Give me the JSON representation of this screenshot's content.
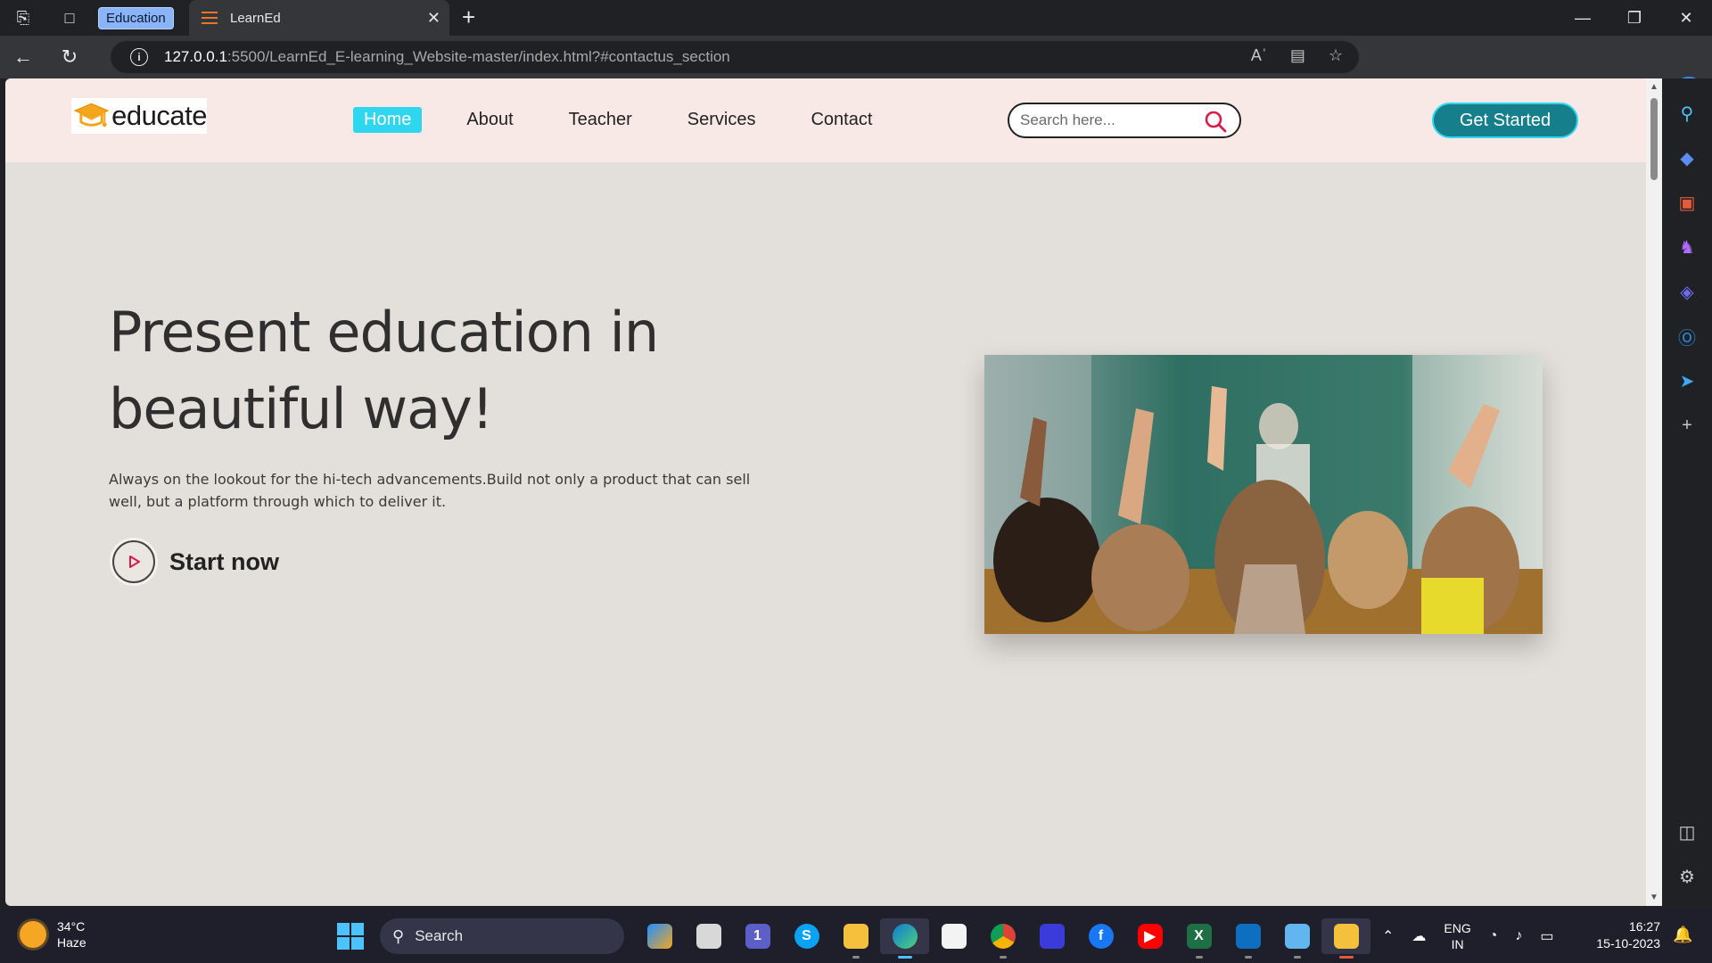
{
  "browser": {
    "tab_group_label": "Education",
    "tab_title": "LearnEd",
    "url_host": "127.0.0.1",
    "url_path": ":5500/LearnEd_E-learning_Website-master/index.html?#contactus_section"
  },
  "site": {
    "logo_text": "educate",
    "nav": [
      {
        "label": "Home",
        "active": true
      },
      {
        "label": "About"
      },
      {
        "label": "Teacher"
      },
      {
        "label": "Services"
      },
      {
        "label": "Contact"
      }
    ],
    "search_placeholder": "Search here...",
    "cta_label": "Get Started",
    "hero": {
      "title": "Present education in beautiful way!",
      "subtitle": "Always on the lookout for the hi-tech advancements.Build not only a product that can sell well, but a platform through which to deliver it.",
      "start_label": "Start now"
    },
    "colors": {
      "header_bg": "#f8e9e6",
      "page_bg": "#e3dfda",
      "active_nav": "#2fd6ef",
      "cta_bg": "#157f8c",
      "search_icon": "#d81b4a"
    }
  },
  "taskbar": {
    "weather_temp": "34°C",
    "weather_desc": "Haze",
    "search_label": "Search",
    "lang_1": "ENG",
    "lang_2": "IN",
    "time": "16:27",
    "date": "15-10-2023",
    "teams_badge": "1"
  }
}
